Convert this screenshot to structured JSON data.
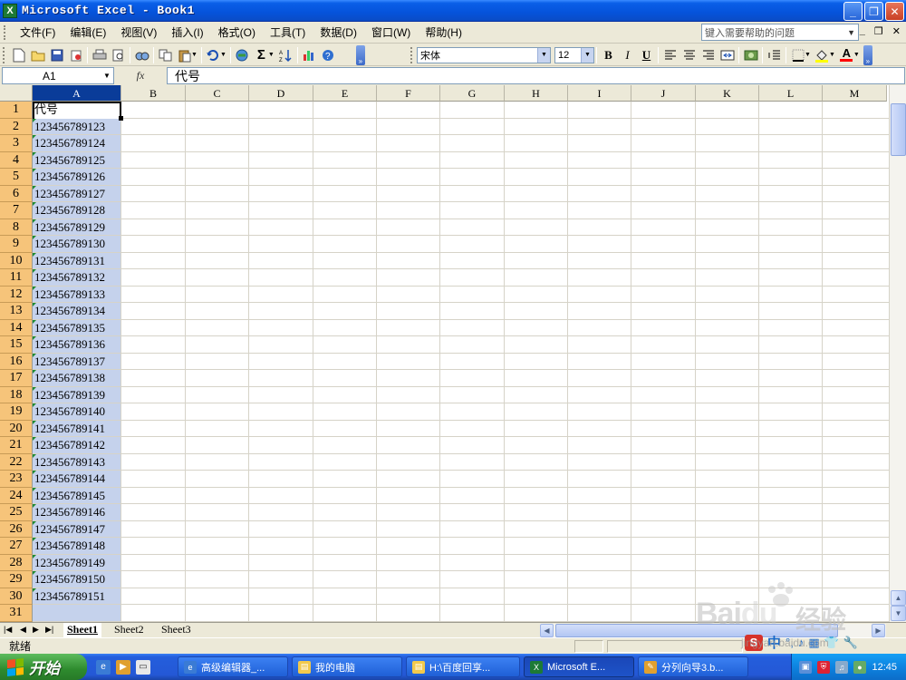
{
  "window": {
    "title": "Microsoft Excel - Book1",
    "icon": "excel-icon",
    "controls": [
      "minimize",
      "restore",
      "close"
    ]
  },
  "menubar": {
    "items": [
      "文件(F)",
      "编辑(E)",
      "视图(V)",
      "插入(I)",
      "格式(O)",
      "工具(T)",
      "数据(D)",
      "窗口(W)",
      "帮助(H)"
    ],
    "help_placeholder": "键入需要帮助的问题"
  },
  "toolbar": {
    "font_name": "宋体",
    "font_size": "12",
    "bold_label": "B",
    "italic_label": "I",
    "underline_label": "U",
    "sum_label": "Σ",
    "font_color_label": "A",
    "font_color": "#FF0000",
    "fill_color": "#FFFF00"
  },
  "formula_bar": {
    "cell_ref": "A1",
    "fx_label": "fx",
    "content": "代号"
  },
  "grid": {
    "columns": [
      "A",
      "B",
      "C",
      "D",
      "E",
      "F",
      "G",
      "H",
      "I",
      "J",
      "K",
      "L",
      "M"
    ],
    "selected_column": "A",
    "rows": [
      {
        "n": "1",
        "a": "代号"
      },
      {
        "n": "2",
        "a": "123456789123"
      },
      {
        "n": "3",
        "a": "123456789124"
      },
      {
        "n": "4",
        "a": "123456789125"
      },
      {
        "n": "5",
        "a": "123456789126"
      },
      {
        "n": "6",
        "a": "123456789127"
      },
      {
        "n": "7",
        "a": "123456789128"
      },
      {
        "n": "8",
        "a": "123456789129"
      },
      {
        "n": "9",
        "a": "123456789130"
      },
      {
        "n": "10",
        "a": "123456789131"
      },
      {
        "n": "11",
        "a": "123456789132"
      },
      {
        "n": "12",
        "a": "123456789133"
      },
      {
        "n": "13",
        "a": "123456789134"
      },
      {
        "n": "14",
        "a": "123456789135"
      },
      {
        "n": "15",
        "a": "123456789136"
      },
      {
        "n": "16",
        "a": "123456789137"
      },
      {
        "n": "17",
        "a": "123456789138"
      },
      {
        "n": "18",
        "a": "123456789139"
      },
      {
        "n": "19",
        "a": "123456789140"
      },
      {
        "n": "20",
        "a": "123456789141"
      },
      {
        "n": "21",
        "a": "123456789142"
      },
      {
        "n": "22",
        "a": "123456789143"
      },
      {
        "n": "23",
        "a": "123456789144"
      },
      {
        "n": "24",
        "a": "123456789145"
      },
      {
        "n": "25",
        "a": "123456789146"
      },
      {
        "n": "26",
        "a": "123456789147"
      },
      {
        "n": "27",
        "a": "123456789148"
      },
      {
        "n": "28",
        "a": "123456789149"
      },
      {
        "n": "29",
        "a": "123456789150"
      },
      {
        "n": "30",
        "a": "123456789151"
      },
      {
        "n": "31",
        "a": ""
      }
    ]
  },
  "sheets": {
    "tabs": [
      "Sheet1",
      "Sheet2",
      "Sheet3"
    ],
    "active": "Sheet1"
  },
  "status": {
    "text": "就绪"
  },
  "taskbar": {
    "start_label": "开始",
    "buttons": [
      {
        "label": "高级编辑器_...",
        "icon": "ie-icon"
      },
      {
        "label": "我的电脑",
        "icon": "folder-icon"
      },
      {
        "label": "H:\\百度回享...",
        "icon": "folder-icon"
      },
      {
        "label": "Microsoft E...",
        "icon": "excel-icon",
        "active": true
      },
      {
        "label": "分列向导3.b...",
        "icon": "paint-icon"
      }
    ],
    "ime_label": "中",
    "clock": "12:45"
  },
  "watermark": {
    "logo": "Bai",
    "logo2": "du",
    "text": "经验",
    "url": "jingyan.baidu.com"
  }
}
